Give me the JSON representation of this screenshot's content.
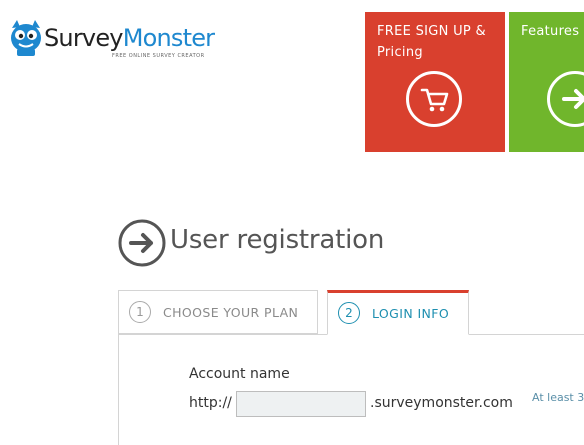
{
  "logo": {
    "word_survey": "Survey",
    "word_monster": "Monster",
    "tagline": "FREE ONLINE SURVEY CREATOR"
  },
  "tiles": [
    {
      "label": "FREE SIGN UP & Pricing",
      "icon": "cart-icon",
      "color": "#d9402e"
    },
    {
      "label": "Features",
      "icon": "arrow-right-icon",
      "color": "#70b62c"
    }
  ],
  "page": {
    "title": "User registration",
    "title_icon": "arrow-right-circle-icon"
  },
  "tabs": [
    {
      "number": "1",
      "label": "CHOOSE YOUR PLAN",
      "active": false
    },
    {
      "number": "2",
      "label": "LOGIN INFO",
      "active": true
    }
  ],
  "form": {
    "account_label": "Account name",
    "prefix": "http://",
    "account_value": "",
    "suffix": ".surveymonster.com",
    "hint": "At least 3"
  },
  "colors": {
    "accent_red": "#d9402e",
    "accent_green": "#70b62c",
    "accent_blue": "#1e8fb0"
  }
}
